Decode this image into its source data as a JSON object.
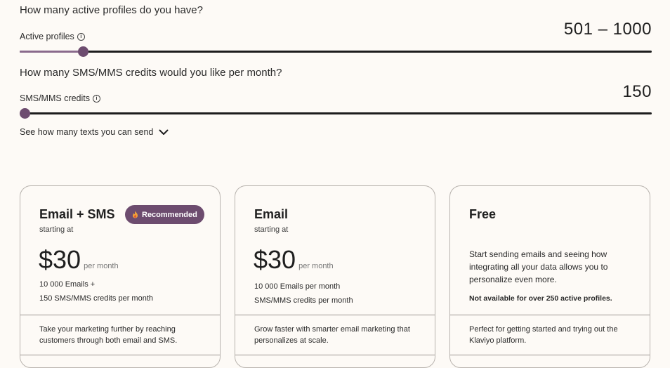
{
  "profiles": {
    "question": "How many active profiles do you have?",
    "label": "Active profiles",
    "value": "501 – 1000",
    "slider_fraction": 0.05
  },
  "sms": {
    "question": "How many SMS/MMS credits would you like per month?",
    "label": "SMS/MMS credits",
    "value": "150",
    "slider_fraction": 0.0
  },
  "see_link": "See how many texts you can send",
  "colors": {
    "accent": "#6d4c6f",
    "track": "#1d1d1d",
    "background": "#fdfaf6"
  },
  "plans": [
    {
      "title": "Email + SMS",
      "badge": "Recommended",
      "starting": "starting at",
      "price": "$30",
      "per": "per month",
      "line1": "10 000 Emails +",
      "line2": "150 SMS/MMS credits per month",
      "desc": "Take your marketing further by reaching customers through both email and SMS."
    },
    {
      "title": "Email",
      "starting": "starting at",
      "price": "$30",
      "per": "per month",
      "line1": "10 000 Emails per month",
      "line2": "SMS/MMS credits per month",
      "desc": "Grow faster with smarter email marketing that personalizes at scale."
    },
    {
      "title": "Free",
      "text": "Start sending emails and seeing how integrating all your data allows you to personalize even more.",
      "note": "Not available for over 250 active profiles.",
      "desc": "Perfect for getting started and trying out the Klaviyo platform."
    }
  ]
}
